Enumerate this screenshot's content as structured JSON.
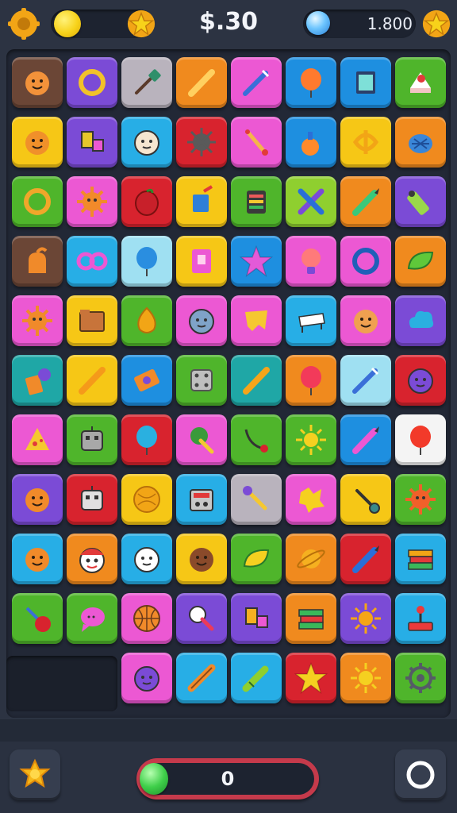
{
  "hud": {
    "money": "$.30",
    "gems": "1.800"
  },
  "progress": {
    "value_label": "0",
    "fill_fraction": 0
  },
  "colors": {
    "brown": "#6b4636",
    "purple": "#7b4bd6",
    "gray": "#b9b3bd",
    "orange": "#f08a1e",
    "pink": "#ec58d3",
    "blue": "#1e8fe0",
    "teal": "#1fa7a6",
    "green": "#4fb52b",
    "yellow": "#f6c716",
    "red": "#d8232e",
    "lightblue": "#9fe0f2",
    "skyblue": "#27aee6",
    "white": "#f4f4f4",
    "lime": "#8fcf2f",
    "darkgray": "#3a4150",
    "dkgreen": "#3b8a3a"
  },
  "tiles": [
    {
      "icon": "face-icon",
      "bg": "brown",
      "fg": "#f3923a"
    },
    {
      "icon": "ring-icon",
      "bg": "purple",
      "fg": "#f2c22a"
    },
    {
      "icon": "brush-icon",
      "bg": "gray",
      "fg": "#2f8f6a"
    },
    {
      "icon": "bat-icon",
      "bg": "orange",
      "fg": "#ffd060"
    },
    {
      "icon": "syringe-icon",
      "bg": "pink",
      "fg": "#3b6fd8"
    },
    {
      "icon": "balloon-icon",
      "bg": "blue",
      "fg": "#ff7a2e"
    },
    {
      "icon": "frame-icon",
      "bg": "blue",
      "fg": "#7ee0d8"
    },
    {
      "icon": "cake-icon",
      "bg": "green",
      "fg": "#ffffff"
    },
    {
      "icon": "face-icon",
      "bg": "yellow",
      "fg": "#f0902a"
    },
    {
      "icon": "blocks-icon",
      "bg": "purple",
      "fg": "#e6c62a"
    },
    {
      "icon": "ball-face-icon",
      "bg": "skyblue",
      "fg": "#f5e6d0"
    },
    {
      "icon": "spiky-ball-icon",
      "bg": "red",
      "fg": "#5a5a5a"
    },
    {
      "icon": "stick-icon",
      "bg": "pink",
      "fg": "#f5b54a"
    },
    {
      "icon": "bottle-icon",
      "bg": "blue",
      "fg": "#ff8a2a"
    },
    {
      "icon": "knot-icon",
      "bg": "yellow",
      "fg": "#f2a516"
    },
    {
      "icon": "shell-icon",
      "bg": "orange",
      "fg": "#3a86d8"
    },
    {
      "icon": "ring-icon",
      "bg": "green",
      "fg": "#f0a72a"
    },
    {
      "icon": "sun-face-icon",
      "bg": "pink",
      "fg": "#f28a2a"
    },
    {
      "icon": "pepper-icon",
      "bg": "red",
      "fg": "#c8202a"
    },
    {
      "icon": "pen-icon",
      "bg": "yellow",
      "fg": "#2f7fd8"
    },
    {
      "icon": "bag-icon",
      "bg": "green",
      "fg": "#ec5a5a"
    },
    {
      "icon": "cross-icon",
      "bg": "lime",
      "fg": "#7a4bd8"
    },
    {
      "icon": "pencil-icon",
      "bg": "orange",
      "fg": "#3ac87a"
    },
    {
      "icon": "tube-icon",
      "bg": "purple",
      "fg": "#9ad84a"
    },
    {
      "icon": "kettle-icon",
      "bg": "brown",
      "fg": "#f08a2a"
    },
    {
      "icon": "goggles-icon",
      "bg": "skyblue",
      "fg": "#ec58d3"
    },
    {
      "icon": "balloon-icon",
      "bg": "lightblue",
      "fg": "#2a8ee0"
    },
    {
      "icon": "card-icon",
      "bg": "yellow",
      "fg": "#ec58d3"
    },
    {
      "icon": "star-icon",
      "bg": "blue",
      "fg": "#e35ad8"
    },
    {
      "icon": "bulb-icon",
      "bg": "pink",
      "fg": "#ff7a7a"
    },
    {
      "icon": "ring-icon",
      "bg": "pink",
      "fg": "#1f5fb8"
    },
    {
      "icon": "leaf-icon",
      "bg": "orange",
      "fg": "#5fc83a"
    },
    {
      "icon": "sun-face-icon",
      "bg": "pink",
      "fg": "#f08a2a"
    },
    {
      "icon": "folder-icon",
      "bg": "yellow",
      "fg": "#c8743a"
    },
    {
      "icon": "onion-icon",
      "bg": "green",
      "fg": "#f2a516"
    },
    {
      "icon": "ball-face-icon",
      "bg": "pink",
      "fg": "#7fa3c8"
    },
    {
      "icon": "cloth-icon",
      "bg": "pink",
      "fg": "#f5c830"
    },
    {
      "icon": "table-icon",
      "bg": "skyblue",
      "fg": "#ffffff"
    },
    {
      "icon": "face-icon",
      "bg": "pink",
      "fg": "#f0a050"
    },
    {
      "icon": "cloud-icon",
      "bg": "purple",
      "fg": "#2ab0e0"
    },
    {
      "icon": "juice-icon",
      "bg": "teal",
      "fg": "#f08a2a"
    },
    {
      "icon": "bat-icon",
      "bg": "yellow",
      "fg": "#f59a1a"
    },
    {
      "icon": "ticket-icon",
      "bg": "blue",
      "fg": "#f08a2a"
    },
    {
      "icon": "dice-icon",
      "bg": "green",
      "fg": "#bfbfbf"
    },
    {
      "icon": "bat-icon",
      "bg": "teal",
      "fg": "#f5a51a"
    },
    {
      "icon": "balloon-icon",
      "bg": "orange",
      "fg": "#f23a5a"
    },
    {
      "icon": "syringe-icon",
      "bg": "lightblue",
      "fg": "#3a6fd8"
    },
    {
      "icon": "ball-face-icon",
      "bg": "red",
      "fg": "#7b4bd6"
    },
    {
      "icon": "cheese-icon",
      "bg": "pink",
      "fg": "#f5c830"
    },
    {
      "icon": "robot-icon",
      "bg": "green",
      "fg": "#a8a8a8"
    },
    {
      "icon": "balloon-icon",
      "bg": "red",
      "fg": "#2ab0e0"
    },
    {
      "icon": "tree-icon",
      "bg": "pink",
      "fg": "#3a9a3a"
    },
    {
      "icon": "hook-icon",
      "bg": "green",
      "fg": "#d8232e"
    },
    {
      "icon": "sun-icon",
      "bg": "green",
      "fg": "#f5d020"
    },
    {
      "icon": "pencil-icon",
      "bg": "blue",
      "fg": "#ec58d3"
    },
    {
      "icon": "balloon-icon",
      "bg": "white",
      "fg": "#f23a2a"
    },
    {
      "icon": "face-icon",
      "bg": "purple",
      "fg": "#f08a2a"
    },
    {
      "icon": "robot-icon",
      "bg": "red",
      "fg": "#e0e0e0"
    },
    {
      "icon": "ball-icon",
      "bg": "yellow",
      "fg": "#f2a516"
    },
    {
      "icon": "radio-icon",
      "bg": "skyblue",
      "fg": "#c8c8c8"
    },
    {
      "icon": "hammer-icon",
      "bg": "gray",
      "fg": "#7b4bd6"
    },
    {
      "icon": "splash-icon",
      "bg": "pink",
      "fg": "#f5d020"
    },
    {
      "icon": "wrench-icon",
      "bg": "yellow",
      "fg": "#3a8a8a"
    },
    {
      "icon": "sun-face-icon",
      "bg": "green",
      "fg": "#f0602a"
    },
    {
      "icon": "face-icon",
      "bg": "skyblue",
      "fg": "#f08a2a"
    },
    {
      "icon": "mask-icon",
      "bg": "orange",
      "fg": "#ffffff"
    },
    {
      "icon": "ball-face-icon",
      "bg": "skyblue",
      "fg": "#ffffff"
    },
    {
      "icon": "face-icon",
      "bg": "yellow",
      "fg": "#8a4a2a"
    },
    {
      "icon": "leaf-icon",
      "bg": "green",
      "fg": "#f5d020"
    },
    {
      "icon": "planet-icon",
      "bg": "orange",
      "fg": "#f5b020"
    },
    {
      "icon": "pencil-icon",
      "bg": "red",
      "fg": "#2a6fd8"
    },
    {
      "icon": "books-icon",
      "bg": "skyblue",
      "fg": "#f2a516"
    },
    {
      "icon": "rattle-icon",
      "bg": "green",
      "fg": "#d8232e"
    },
    {
      "icon": "bubble-icon",
      "bg": "green",
      "fg": "#ec58d3"
    },
    {
      "icon": "basketball-icon",
      "bg": "pink",
      "fg": "#f08a2a"
    },
    {
      "icon": "lollipop-icon",
      "bg": "purple",
      "fg": "#ec3a5a"
    },
    {
      "icon": "blocks-icon",
      "bg": "purple",
      "fg": "#f5b020"
    },
    {
      "icon": "books-icon",
      "bg": "orange",
      "fg": "#3ab85a"
    },
    {
      "icon": "sun-icon",
      "bg": "purple",
      "fg": "#f5a516"
    },
    {
      "icon": "joystick-icon",
      "bg": "skyblue",
      "fg": "#ec3a3a"
    },
    {
      "icon": "empty-slot",
      "bg": "none",
      "fg": "none"
    },
    {
      "icon": "empty-slot",
      "bg": "none",
      "fg": "none"
    },
    {
      "icon": "ball-face-icon",
      "bg": "pink",
      "fg": "#7b4bd6"
    },
    {
      "icon": "roller-icon",
      "bg": "skyblue",
      "fg": "#f08a2a"
    },
    {
      "icon": "crayon-icon",
      "bg": "skyblue",
      "fg": "#8fcf2f"
    },
    {
      "icon": "star-icon",
      "bg": "red",
      "fg": "#f5d020"
    },
    {
      "icon": "sun-icon",
      "bg": "orange",
      "fg": "#f5d020"
    },
    {
      "icon": "gear-icon",
      "bg": "green",
      "fg": "#555b66"
    }
  ]
}
